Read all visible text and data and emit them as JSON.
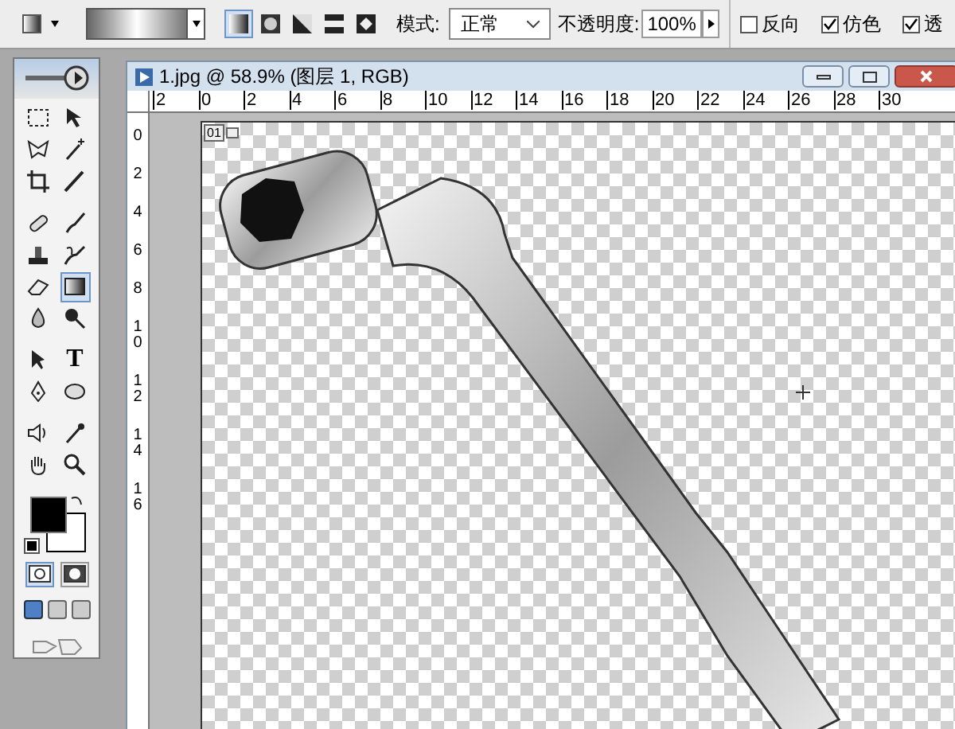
{
  "options_bar": {
    "gradient_types": [
      {
        "kind": "linear",
        "selected": true
      },
      {
        "kind": "radial",
        "selected": false
      },
      {
        "kind": "angle",
        "selected": false
      },
      {
        "kind": "reflected",
        "selected": false
      },
      {
        "kind": "diamond",
        "selected": false
      }
    ],
    "mode_label": "模式:",
    "mode_value": "正常",
    "opacity_label": "不透明度:",
    "opacity_value": "100%",
    "checkboxes": [
      {
        "label": "反向",
        "checked": false
      },
      {
        "label": "仿色",
        "checked": true
      },
      {
        "label": "透",
        "checked": true
      }
    ]
  },
  "toolbox": {
    "tools": [
      {
        "kind": "marquee",
        "selected": false
      },
      {
        "kind": "move",
        "selected": false
      },
      {
        "kind": "lasso",
        "selected": false
      },
      {
        "kind": "wand",
        "selected": false
      },
      {
        "kind": "crop",
        "selected": false
      },
      {
        "kind": "slice",
        "selected": false
      },
      {
        "kind": "bandage",
        "selected": false
      },
      {
        "kind": "brush",
        "selected": false
      },
      {
        "kind": "stamp",
        "selected": false
      },
      {
        "kind": "history",
        "selected": false
      },
      {
        "kind": "eraser",
        "selected": false
      },
      {
        "kind": "gradient",
        "selected": true
      },
      {
        "kind": "drop",
        "selected": false
      },
      {
        "kind": "dodge",
        "selected": false
      },
      {
        "kind": "arrow",
        "selected": false
      },
      {
        "kind": "type",
        "selected": false,
        "text": "T"
      },
      {
        "kind": "pen",
        "selected": false
      },
      {
        "kind": "ellipse",
        "selected": false
      },
      {
        "kind": "speaker",
        "selected": false
      },
      {
        "kind": "eyedropper",
        "selected": false
      },
      {
        "kind": "hand",
        "selected": false
      },
      {
        "kind": "zoom",
        "selected": false
      }
    ],
    "mask_modes": [
      {
        "selected": true
      },
      {
        "selected": false
      }
    ],
    "screen_modes": [
      {
        "selected": true
      },
      {
        "selected": false
      },
      {
        "selected": false
      }
    ]
  },
  "document": {
    "title": "1.jpg @ 58.9% (图层 1, RGB)",
    "top_ruler": [
      "2",
      "0",
      "2",
      "4",
      "6",
      "8",
      "10",
      "12",
      "14",
      "16",
      "18",
      "20",
      "22",
      "24",
      "26",
      "28",
      "30"
    ],
    "left_ruler": [
      "0",
      "2",
      "4",
      "6",
      "8",
      "10",
      "12",
      "14",
      "16"
    ],
    "layer_tag": "01"
  }
}
